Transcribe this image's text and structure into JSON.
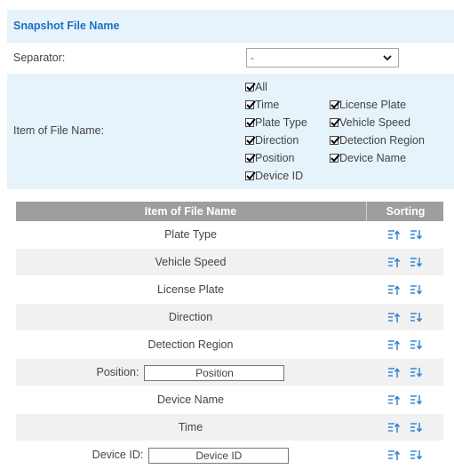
{
  "section": {
    "title": "Snapshot File Name"
  },
  "separator": {
    "label": "Separator:",
    "value": "-"
  },
  "items": {
    "label": "Item of File Name:",
    "checkboxes": [
      {
        "label": "All",
        "checked": true
      },
      {
        "label": "Time",
        "checked": true
      },
      {
        "label": "License Plate",
        "checked": true
      },
      {
        "label": "Plate Type",
        "checked": true
      },
      {
        "label": "Vehicle Speed",
        "checked": true
      },
      {
        "label": "Direction",
        "checked": true
      },
      {
        "label": "Detection Region",
        "checked": true
      },
      {
        "label": "Position",
        "checked": true
      },
      {
        "label": "Device Name",
        "checked": true
      },
      {
        "label": "Device ID",
        "checked": true
      }
    ]
  },
  "table": {
    "headers": [
      "Item of File Name",
      "Sorting"
    ],
    "rows": [
      {
        "name": "Plate Type"
      },
      {
        "name": "Vehicle Speed"
      },
      {
        "name": "License Plate"
      },
      {
        "name": "Direction"
      },
      {
        "name": "Detection Region"
      },
      {
        "field_label": "Position:",
        "field_value": "Position"
      },
      {
        "name": "Device Name"
      },
      {
        "name": "Time"
      },
      {
        "field_label": "Device ID:",
        "field_value": "Device ID"
      }
    ]
  },
  "colors": {
    "accent": "#1f6fc4",
    "header_bg": "#e6f3fb",
    "table_head": "#9e9e9e",
    "sort_icon": "#2a7fd4"
  },
  "icons": {
    "sort_up": "sort-ascending-icon",
    "sort_down": "sort-descending-icon",
    "dropdown": "chevron-down-icon"
  }
}
